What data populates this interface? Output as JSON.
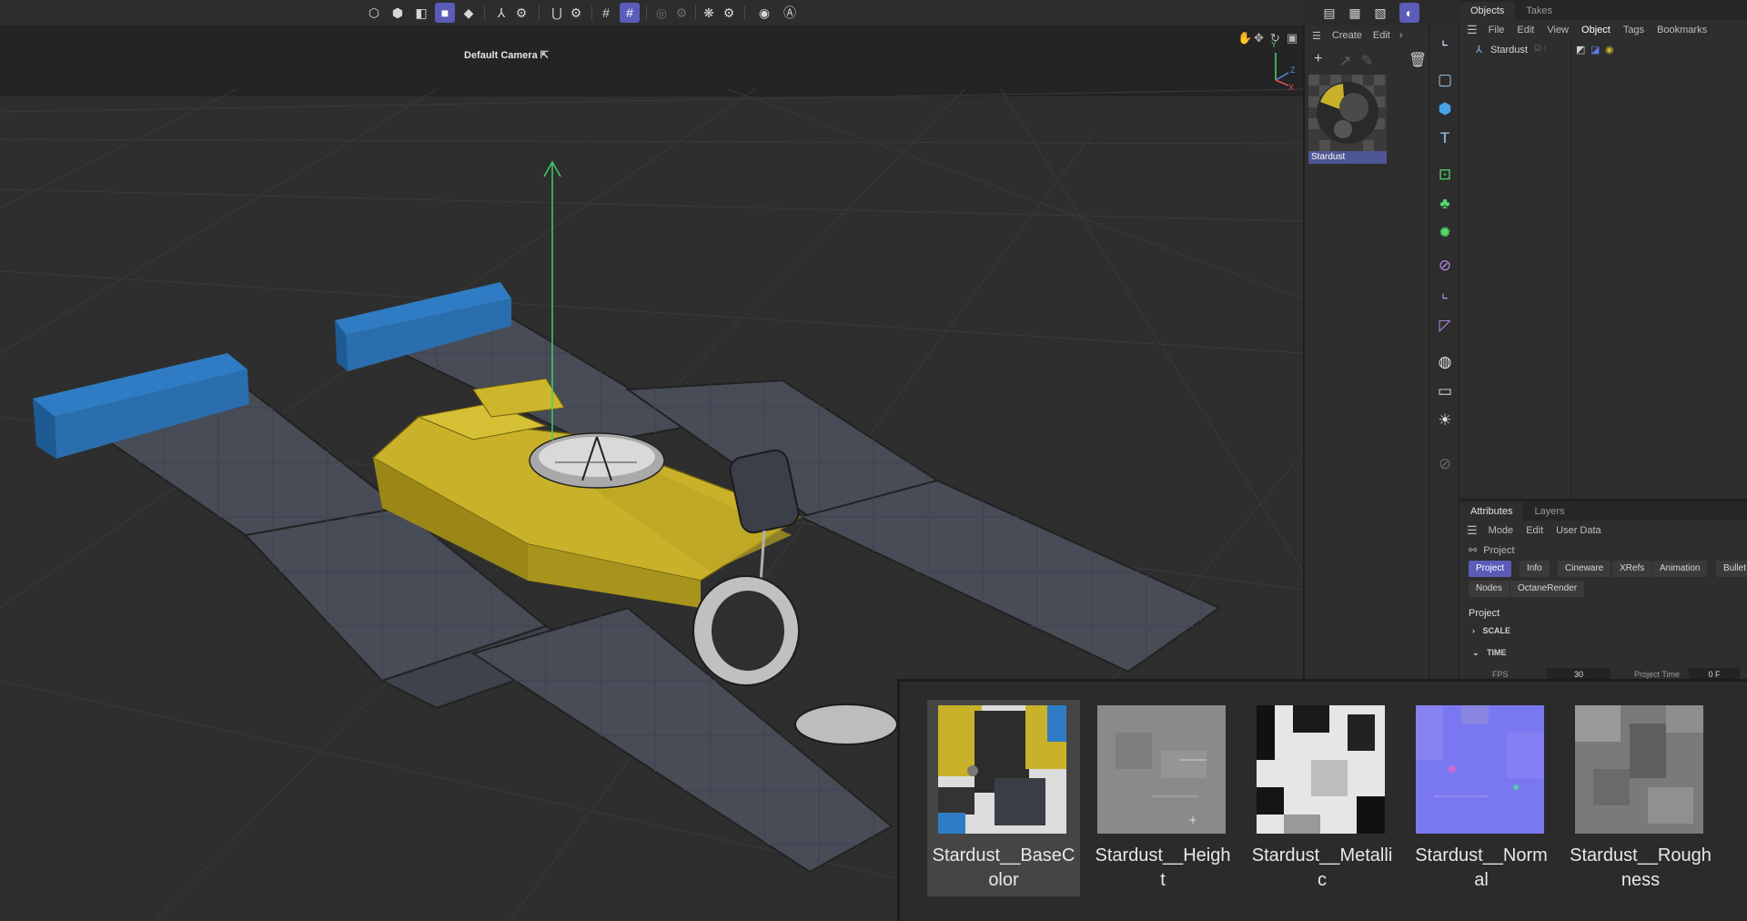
{
  "toolbar": {
    "icons": [
      "object-mode-icon",
      "polygon-mode-icon",
      "edge-mode-icon",
      "point-mode-icon",
      "model-mode-icon",
      "axis-icon",
      "axis-settings-icon",
      "magnet-icon",
      "magnet-settings-icon",
      "workplane-grid-icon",
      "snap-grid-icon",
      "render-region-icon",
      "render-settings-icon",
      "symmetry-icon",
      "symmetry-settings-icon",
      "hud-icon",
      "auto-icon"
    ],
    "right_icons": [
      "render-view-icon",
      "render-picture-viewer-icon",
      "edit-render-settings-icon",
      "ipr-icon"
    ]
  },
  "viewport": {
    "camera_label": "Default Camera",
    "axis_labels": {
      "y": "Y",
      "z": "Z",
      "x": "X"
    }
  },
  "material_manager": {
    "menu": {
      "create": "Create",
      "edit": "Edit"
    },
    "material_name": "Stardust"
  },
  "objects_manager": {
    "tabs": [
      "Objects",
      "Takes"
    ],
    "menu": [
      "File",
      "Edit",
      "View",
      "Object",
      "Tags",
      "Bookmarks"
    ],
    "object_name": "Stardust"
  },
  "attributes_manager": {
    "tabs": [
      "Attributes",
      "Layers"
    ],
    "menu": [
      "Mode",
      "Edit",
      "User Data"
    ],
    "context": "Project",
    "buttons_row1": [
      "Project",
      "Info",
      "Cineware",
      "XRefs",
      "Animation",
      "Bullet"
    ],
    "buttons_row2": [
      "Nodes",
      "OctaneRender"
    ],
    "section_title": "Project",
    "groups": [
      "SCALE",
      "TIME"
    ],
    "fields": {
      "fps_label": "FPS",
      "fps_value": "30",
      "project_time_label": "Project Time",
      "project_time_value": "0 F"
    }
  },
  "textures": [
    {
      "label": "Stardust__BaseColor",
      "line1": "Stardust__BaseC",
      "line2": "olor"
    },
    {
      "label": "Stardust__Height",
      "line1": "Stardust__Heigh",
      "line2": "t"
    },
    {
      "label": "Stardust__Metallic",
      "line1": "Stardust__Metalli",
      "line2": "c"
    },
    {
      "label": "Stardust__Normal",
      "line1": "Stardust__Norm",
      "line2": "al"
    },
    {
      "label": "Stardust__Roughness",
      "line1": "Stardust__Rough",
      "line2": "ness"
    }
  ],
  "colors": {
    "accent": "#5a5cb8",
    "panel_yellow": "#c9b22a",
    "panel_blue": "#2f7cc4",
    "solar_panel": "#4a4f5a",
    "axis_green": "#3fcf6a"
  }
}
